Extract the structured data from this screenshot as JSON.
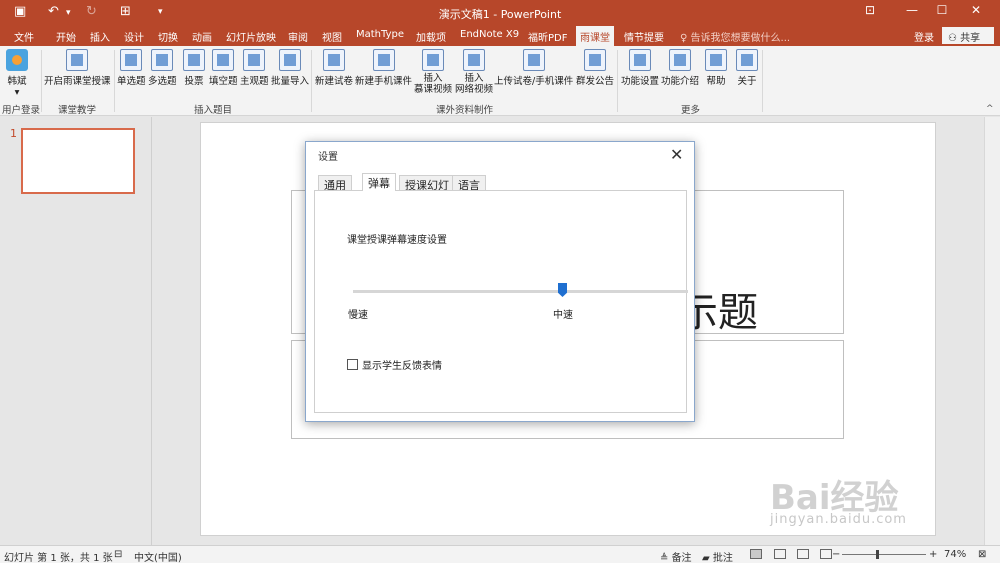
{
  "app": {
    "title": "演示文稿1 - PowerPoint"
  },
  "colors": {
    "accent": "#b7472a",
    "slider": "#1f6fd0"
  },
  "quick_access": {
    "save_icon": "save-icon",
    "undo_icon": "undo-icon",
    "redo_icon": "redo-icon",
    "present_icon": "present-icon",
    "customize_icon": "chevron-down-icon"
  },
  "tabs": [
    "文件",
    "开始",
    "插入",
    "设计",
    "切换",
    "动画",
    "幻灯片放映",
    "审阅",
    "视图",
    "MathType",
    "加载项",
    "EndNote X9",
    "福昕PDF",
    "雨课堂",
    "情节提要"
  ],
  "active_tab": "雨课堂",
  "tell_me": "告诉我您想要做什么...",
  "login": "登录",
  "share": "共享",
  "ribbon": {
    "user": {
      "label": "韩斌",
      "group": "用户登录"
    },
    "teaching": {
      "label": "开启雨课堂授课",
      "group": "课堂教学"
    },
    "questions": {
      "items": [
        "单选题",
        "多选题",
        "投票",
        "填空题",
        "主观题",
        "批量导入"
      ],
      "group": "插入题目"
    },
    "materials": {
      "items": [
        "新建试卷",
        "新建手机课件",
        "插入\n慕课视频",
        "插入\n网络视频",
        "上传试卷/手机课件",
        "群发公告"
      ],
      "group": "课外资料制作"
    },
    "more": {
      "items": [
        "功能设置",
        "功能介绍",
        "帮助",
        "关于"
      ],
      "group": "更多"
    }
  },
  "slides_panel": {
    "number": "1"
  },
  "slide": {
    "title_fragment": "示题"
  },
  "dialog": {
    "title": "设置",
    "tabs": [
      "通用",
      "弹幕",
      "授课幻灯",
      "语言"
    ],
    "active_tab": "弹幕",
    "speed_label": "课堂授课弹幕速度设置",
    "slow_label": "慢速",
    "mid_label": "中速",
    "speed_level": 0.5,
    "checkbox_label": "显示学生反馈表情",
    "checkbox_checked": false
  },
  "status": {
    "slide_info": "幻灯片 第 1 张，共 1 张",
    "language": "中文(中国)",
    "notes": "备注",
    "comments": "批注",
    "zoom": "74%"
  },
  "watermark": {
    "brand": "Bai经验",
    "url": "jingyan.baidu.com"
  }
}
